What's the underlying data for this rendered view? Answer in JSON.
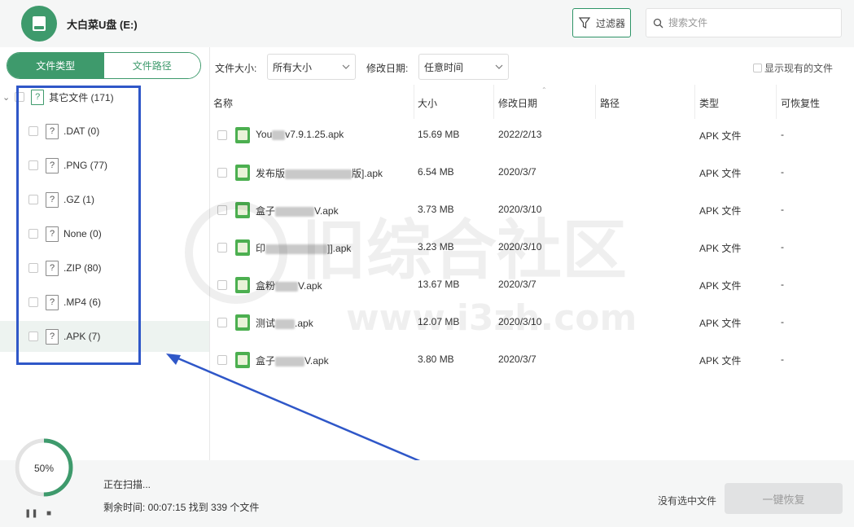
{
  "header": {
    "drive_title": "大白菜U盘 (E:)",
    "filter_label": "过滤器",
    "search_placeholder": "搜索文件"
  },
  "sidebar": {
    "tabs": [
      {
        "label": "文件类型",
        "active": true
      },
      {
        "label": "文件路径",
        "active": false
      }
    ],
    "root": {
      "label": "其它文件 (171)"
    },
    "items": [
      {
        "label": ".DAT (0)"
      },
      {
        "label": ".PNG (77)"
      },
      {
        "label": ".GZ (1)"
      },
      {
        "label": "None (0)"
      },
      {
        "label": ".ZIP (80)"
      },
      {
        "label": ".MP4 (6)"
      },
      {
        "label": ".APK (7)",
        "selected": true
      }
    ]
  },
  "filters": {
    "size_label": "文件大小:",
    "size_value": "所有大小",
    "date_label": "修改日期:",
    "date_value": "任意时间",
    "show_existing_label": "显示现有的文件"
  },
  "table": {
    "headers": {
      "name": "名称",
      "size": "大小",
      "modified": "修改日期",
      "path": "路径",
      "type": "类型",
      "recoverable": "可恢复性"
    },
    "rows": [
      {
        "name_pre": "You",
        "name_post": "v7.9.1.25.apk",
        "size": "15.69 MB",
        "date": "2022/2/13",
        "path": "",
        "type": "APK 文件",
        "recoverable": "-"
      },
      {
        "name_pre": "发布版",
        "name_post": "版].apk",
        "size": "6.54 MB",
        "date": "2020/3/7",
        "path": "",
        "type": "APK 文件",
        "recoverable": "-"
      },
      {
        "name_pre": "盒子",
        "name_post": "V.apk",
        "size": "3.73 MB",
        "date": "2020/3/10",
        "path": "",
        "type": "APK 文件",
        "recoverable": "-"
      },
      {
        "name_pre": "印",
        "name_post": "]].apk",
        "size": "3.23 MB",
        "date": "2020/3/10",
        "path": "",
        "type": "APK 文件",
        "recoverable": "-"
      },
      {
        "name_pre": "盒粉",
        "name_post": "V.apk",
        "size": "13.67 MB",
        "date": "2020/3/7",
        "path": "",
        "type": "APK 文件",
        "recoverable": "-"
      },
      {
        "name_pre": "测试",
        "name_post": ".apk",
        "size": "12.07 MB",
        "date": "2020/3/10",
        "path": "",
        "type": "APK 文件",
        "recoverable": "-"
      },
      {
        "name_pre": "盒子",
        "name_post": "V.apk",
        "size": "3.80 MB",
        "date": "2020/3/7",
        "path": "",
        "type": "APK 文件",
        "recoverable": "-"
      }
    ]
  },
  "footer": {
    "progress_percent_label": "50%",
    "progress_fraction": 0.5,
    "status": "正在扫描...",
    "remaining": "剩余时间: 00:07:15 找到 339 个文件",
    "no_selection": "没有选中文件",
    "recover_button": "一键恢复"
  },
  "watermark": {
    "line1": "旧综合社区",
    "line2": "www.i3zh.com"
  },
  "colors": {
    "accent": "#3e9a6c",
    "annotation": "#2f57c8"
  }
}
